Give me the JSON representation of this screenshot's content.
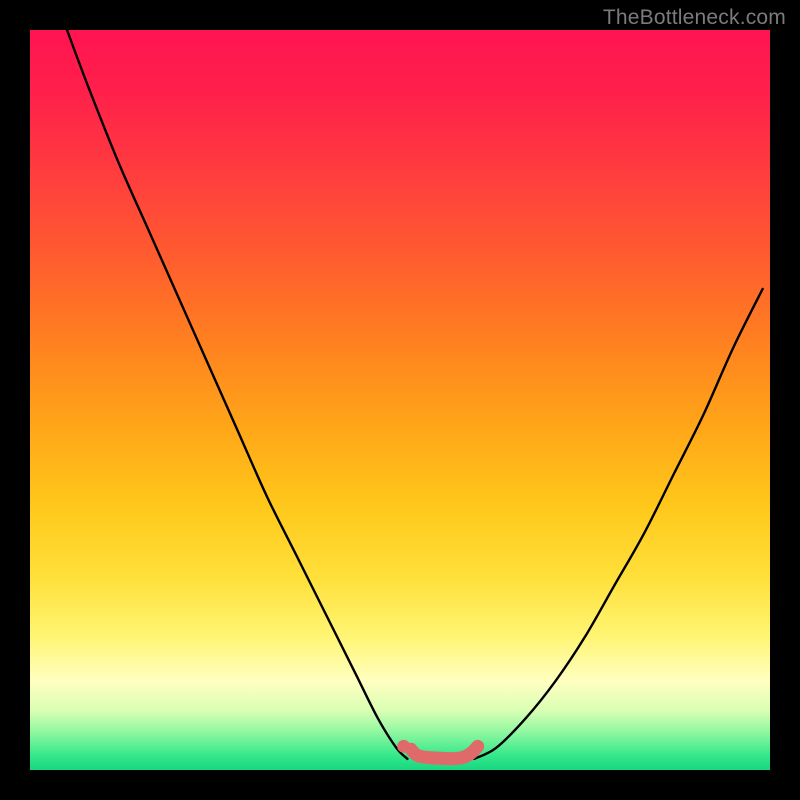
{
  "watermark": "TheBottleneck.com",
  "chart_data": {
    "type": "line",
    "title": "",
    "xlabel": "",
    "ylabel": "",
    "xlim": [
      0,
      100
    ],
    "ylim": [
      0,
      100
    ],
    "series": [
      {
        "name": "left-curve",
        "x": [
          5,
          8,
          12,
          16,
          20,
          24,
          28,
          32,
          36,
          40,
          44,
          47,
          49.5,
          51
        ],
        "y": [
          100,
          92,
          82,
          73,
          64,
          55,
          46,
          37,
          29,
          21,
          13,
          7,
          3,
          1.5
        ]
      },
      {
        "name": "right-curve",
        "x": [
          60,
          63,
          67,
          71,
          75,
          79,
          83,
          87,
          91,
          95,
          99
        ],
        "y": [
          1.5,
          3,
          7,
          12,
          18,
          25,
          32,
          40,
          48,
          57,
          65
        ]
      },
      {
        "name": "green-zone-flat",
        "x": [
          51,
          60
        ],
        "y": [
          1.5,
          1.5
        ]
      }
    ],
    "annotations": [
      {
        "name": "marker-left-end",
        "type": "dot",
        "x": 50.5,
        "y": 3.2,
        "color": "#e06a6a"
      },
      {
        "name": "pink-segment",
        "type": "thick-segment",
        "points": [
          {
            "x": 51.5,
            "y": 2.8
          },
          {
            "x": 52.5,
            "y": 1.9
          },
          {
            "x": 55.0,
            "y": 1.6
          },
          {
            "x": 58.0,
            "y": 1.6
          },
          {
            "x": 59.5,
            "y": 2.2
          },
          {
            "x": 60.5,
            "y": 3.2
          }
        ],
        "color": "#e06a6a"
      }
    ],
    "background": {
      "type": "vertical-gradient",
      "stops": [
        {
          "pos": 0,
          "color": "#ff1452"
        },
        {
          "pos": 50,
          "color": "#ff9b1a"
        },
        {
          "pos": 82,
          "color": "#fff574"
        },
        {
          "pos": 100,
          "color": "#18d780"
        }
      ]
    }
  }
}
